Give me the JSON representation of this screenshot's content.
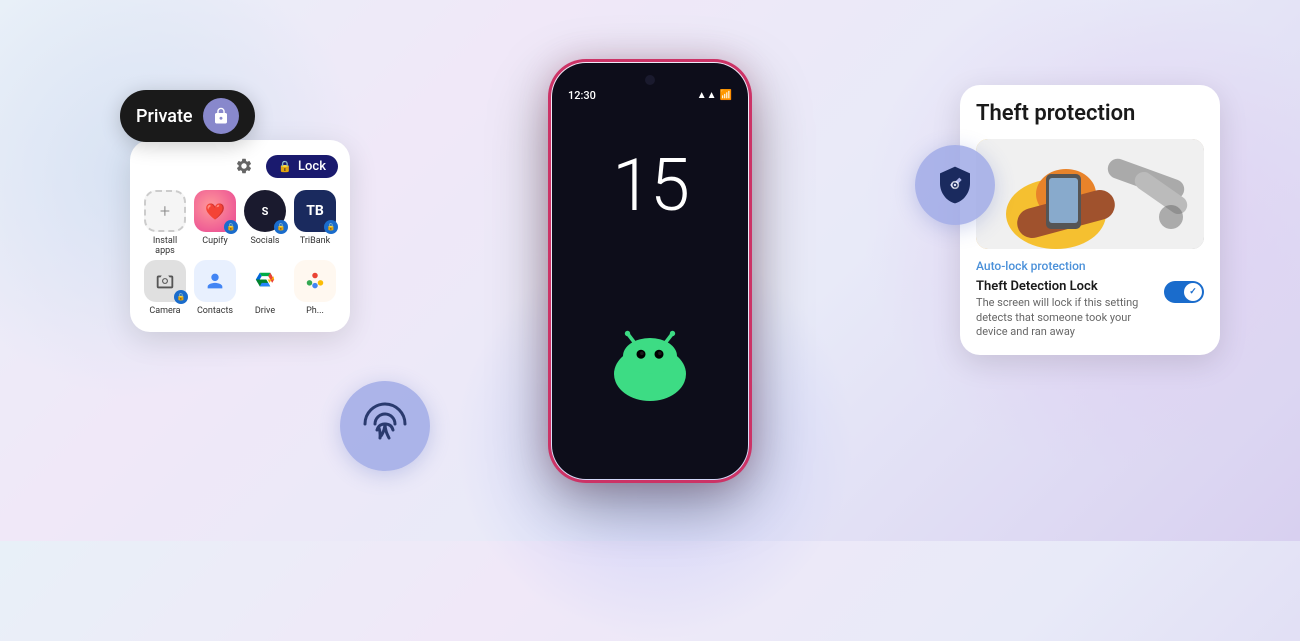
{
  "background": {
    "gradient": "linear-gradient(135deg, #e8f0f8, #f0e8f8, #d8d0f0)"
  },
  "phone": {
    "time": "12:30",
    "number": "15",
    "signal_icon": "▲▲",
    "battery_icon": "▮"
  },
  "private_pill": {
    "label": "Private",
    "lock_icon": "🔒"
  },
  "app_grid": {
    "lock_button_label": "Lock",
    "apps_row1": [
      {
        "name": "Install apps",
        "icon": "+"
      },
      {
        "name": "Cupify",
        "icon": "❤"
      },
      {
        "name": "Socials",
        "icon": "◎"
      },
      {
        "name": "TriBank",
        "icon": "T"
      }
    ],
    "apps_row2": [
      {
        "name": "Camera",
        "icon": "📷"
      },
      {
        "name": "Contacts",
        "icon": "👤"
      },
      {
        "name": "Drive",
        "icon": "△"
      },
      {
        "name": "Photos",
        "icon": "🌸"
      }
    ]
  },
  "theft_protection": {
    "title": "Theft protection",
    "auto_lock_label": "Auto-lock protection",
    "feature_title": "Theft Detection Lock",
    "feature_description": "The screen will lock if this setting detects that someone took your device and ran away",
    "toggle_state": "on"
  },
  "fingerprint": {
    "icon": "fingerprint"
  },
  "shield": {
    "icon": "shield-lock"
  }
}
